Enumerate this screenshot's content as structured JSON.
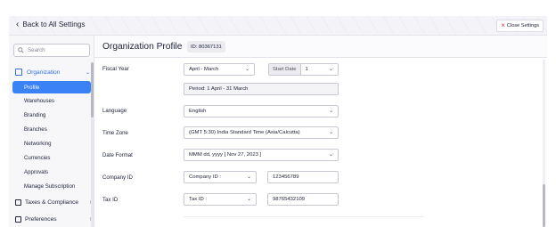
{
  "topbar": {
    "back_label": "Back to All Settings",
    "close_label": "Close Settings"
  },
  "sidebar": {
    "search_placeholder": "Search",
    "section_label": "Organization",
    "items": [
      {
        "label": "Profile",
        "active": true
      },
      {
        "label": "Warehouses"
      },
      {
        "label": "Branding"
      },
      {
        "label": "Branches"
      },
      {
        "label": "Networking"
      },
      {
        "label": "Currencies"
      },
      {
        "label": "Approvals"
      },
      {
        "label": "Manage Subscription"
      }
    ],
    "groups": [
      {
        "label": "Taxes & Compliance"
      },
      {
        "label": "Preferences"
      }
    ]
  },
  "main": {
    "title": "Organization Profile",
    "id_badge": "ID: 80367131",
    "fiscal_year": {
      "label": "Fiscal Year",
      "value": "April - March",
      "start_date_label": "Start Date",
      "start_date_value": "1",
      "period": "Period: 1 April - 31 March"
    },
    "language": {
      "label": "Language",
      "value": "English"
    },
    "time_zone": {
      "label": "Time Zone",
      "value": "(GMT 5:30) India Standard Time (Asia/Calcutta)"
    },
    "date_format": {
      "label": "Date Format",
      "value": "MMM dd, yyyy [ Nov 27, 2023 ]"
    },
    "company_id": {
      "label": "Company ID",
      "type_value": "Company ID :",
      "value": "123456789"
    },
    "tax_id": {
      "label": "Tax ID",
      "type_value": "Tax ID :",
      "value": "98765432109"
    }
  }
}
